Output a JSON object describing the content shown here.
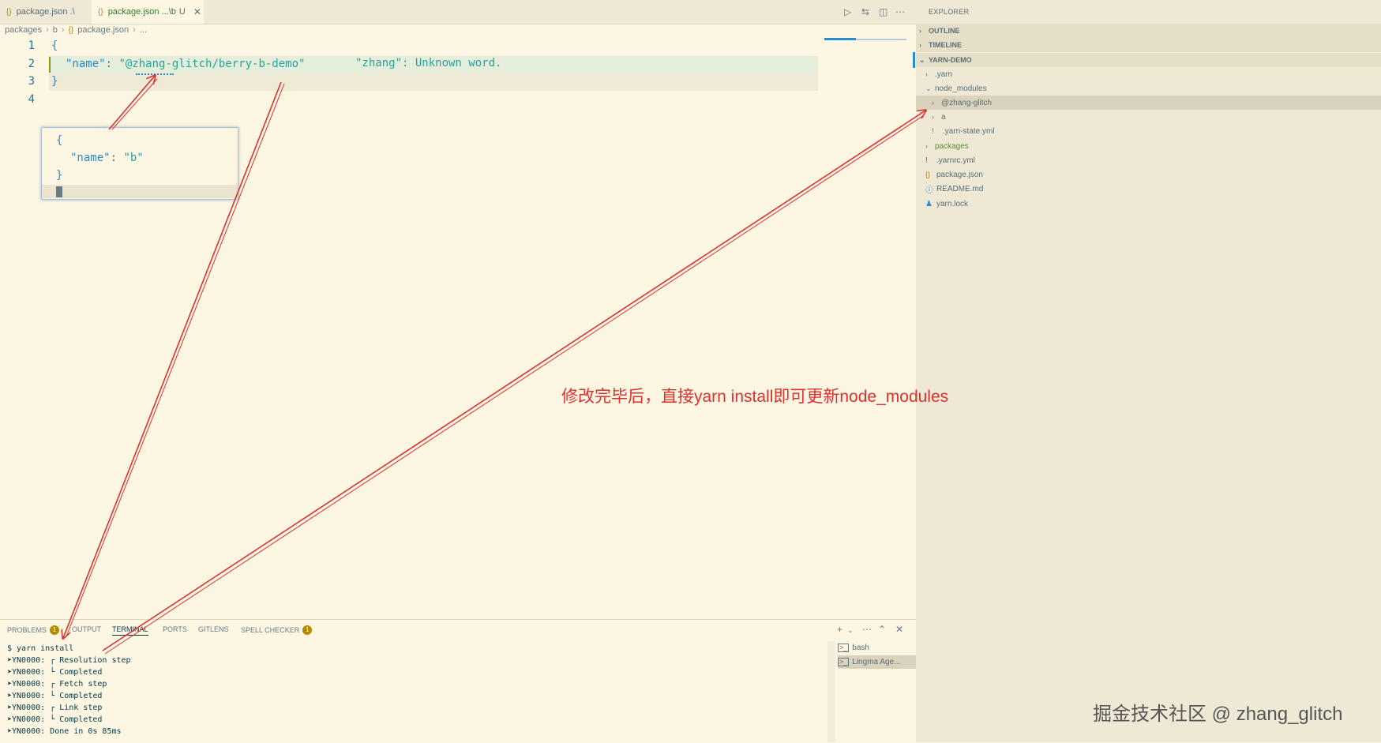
{
  "tabs": [
    {
      "icon": "{}",
      "label": "package.json",
      "suffix": ".\\"
    },
    {
      "icon": "{}",
      "label": "package.json",
      "suffix": "...\\b",
      "status": "U"
    }
  ],
  "breadcrumb": [
    "packages",
    "b",
    "package.json",
    "..."
  ],
  "editor": {
    "line_numbers": [
      "1",
      "2",
      "3",
      "4"
    ],
    "open_brace": "{",
    "name_key": "\"name\"",
    "colon": ": ",
    "name_value": "\"@zhang-glitch/berry-b-demo\"",
    "close_brace": "}",
    "spell_hint": "\"zhang\": Unknown word."
  },
  "peek": {
    "open_brace": "{",
    "name_key": "\"name\"",
    "colon": ": ",
    "name_value": "\"b\"",
    "close_brace": "}"
  },
  "explorer": {
    "title": "EXPLORER",
    "sections": [
      "OUTLINE",
      "TIMELINE",
      "YARN-DEMO"
    ],
    "items": [
      {
        "label": ".yarn"
      },
      {
        "label": "node_modules"
      },
      {
        "label": "@zhang-glitch"
      },
      {
        "label": "a"
      },
      {
        "label": ".yarn-state.yml"
      },
      {
        "label": "packages"
      },
      {
        "label": ".yarnrc.yml"
      },
      {
        "label": "package.json"
      },
      {
        "label": "README.md"
      },
      {
        "label": "yarn.lock"
      }
    ]
  },
  "panel": {
    "tabs": [
      {
        "label": "PROBLEMS",
        "badge": "1"
      },
      {
        "label": "OUTPUT"
      },
      {
        "label": "TERMINAL"
      },
      {
        "label": "PORTS"
      },
      {
        "label": "GITLENS"
      },
      {
        "label": "SPELL CHECKER",
        "badge": "1"
      }
    ],
    "terminal_lines": [
      "$ yarn install",
      "➤YN0000: ┌ Resolution step",
      "➤YN0000: └ Completed",
      "➤YN0000: ┌ Fetch step",
      "➤YN0000: └ Completed",
      "➤YN0000: ┌ Link step",
      "➤YN0000: └ Completed",
      "➤YN0000: Done in 0s 85ms"
    ],
    "terminals": [
      "bash",
      "Lingma Age..."
    ]
  },
  "annotation": "修改完毕后，直接yarn install即可更新node_modules",
  "watermark": "掘金技术社区 @ zhang_glitch",
  "colors": {
    "annotation": "#dc322f",
    "background": "#fdf6e3"
  }
}
